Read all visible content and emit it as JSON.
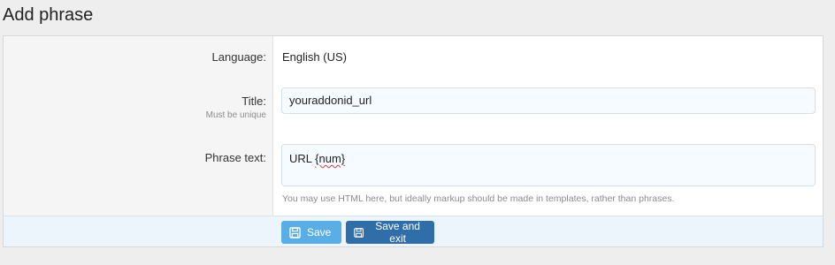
{
  "page": {
    "title": "Add phrase"
  },
  "form": {
    "language": {
      "label": "Language:",
      "value": "English (US)"
    },
    "title": {
      "label": "Title:",
      "hint": "Must be unique",
      "value": "youraddonid_url"
    },
    "phrase_text": {
      "label": "Phrase text:",
      "value_plain": "URL ",
      "value_flagged": "{num}",
      "explain": "You may use HTML here, but ideally markup should be made in templates, rather than phrases."
    }
  },
  "actions": {
    "save_label": "Save",
    "save_exit_label": "Save and exit",
    "icon": "floppy-disk-icon"
  },
  "colors": {
    "save_button": "#5aaee6",
    "save_exit_button": "#2f6ea8",
    "submit_row_bg": "#edf5fc",
    "spellcheck_underline": "#d63b3b"
  }
}
